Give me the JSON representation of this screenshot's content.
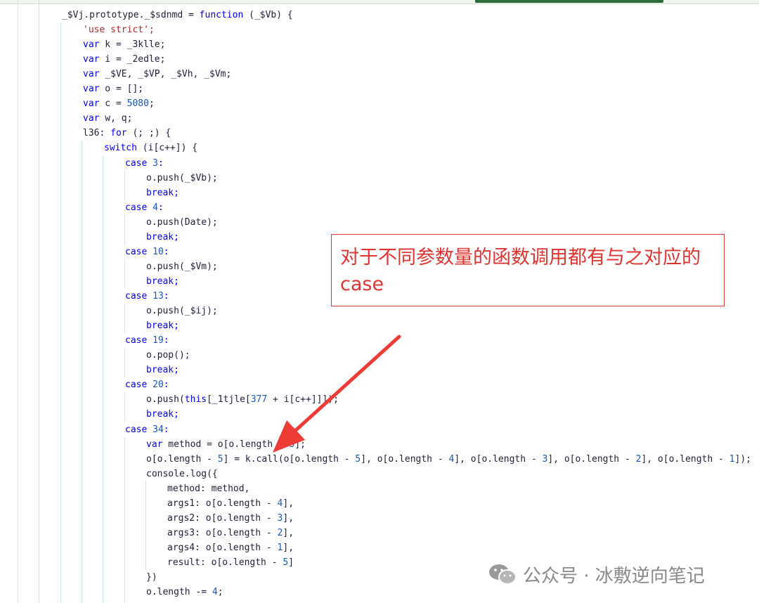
{
  "code": {
    "header": "_$Vj.prototype._$sdnmd = function (_$Vb) {",
    "use_strict": "'use strict';",
    "var_k": "var k = _3klle;",
    "var_i": "var i = _2edle;",
    "var_ve": "var _$VE, _$VP, _$Vh, _$Vm;",
    "var_o": "var o = [];",
    "var_c": "var c = 5080;",
    "var_wq": "var w, q;",
    "loop": "l36: for (; ;) {",
    "switch": "switch (i[c++]) {",
    "case3": "case 3:",
    "push_vb": "o.push(_$Vb);",
    "break": "break;",
    "case4": "case 4:",
    "push_date": "o.push(Date);",
    "case10": "case 10:",
    "push_vm": "o.push(_$Vm);",
    "case13": "case 13:",
    "push_ij": "o.push(_$ij);",
    "case19": "case 19:",
    "pop": "o.pop();",
    "case20": "case 20:",
    "push_this": "o.push(this[_1tjle[377 + i[c++]]]);",
    "case34": "case 34:",
    "var_method": "var method = o[o.length - 5];",
    "call_line": "o[o.length - 5] = k.call(o[o.length - 5], o[o.length - 4], o[o.length - 3], o[o.length - 2], o[o.length - 1]);",
    "console_log": "console.log({",
    "method_prop": "method: method,",
    "args1": "args1: o[o.length - 4],",
    "args2": "args2: o[o.length - 3],",
    "args3": "args3: o[o.length - 2],",
    "args4": "args4: o[o.length - 1],",
    "result": "result: o[o.length - 5]",
    "close_obj": "})",
    "length_dec": "o.length -= 4;"
  },
  "callout": {
    "text": "对于不同参数量的函数调用都有与之对应的case"
  },
  "watermark": {
    "text": "公众号 · 冰敷逆向笔记"
  },
  "colors": {
    "keyword": "#0000ff",
    "string": "#b0272a",
    "number": "#1a55c4",
    "annotation_red": "#e2342f",
    "guide_green": "#c8ead2"
  }
}
